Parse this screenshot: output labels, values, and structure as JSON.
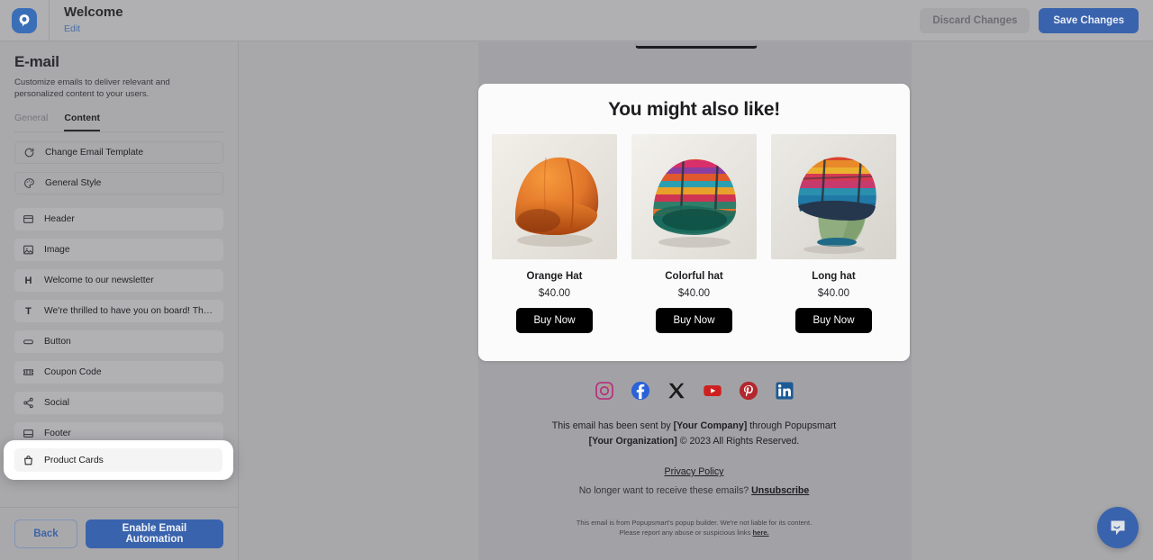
{
  "topbar": {
    "logo_icon": "popupsmart-logo-icon",
    "title": "Welcome",
    "edit_link": "Edit",
    "discard_label": "Discard Changes",
    "save_label": "Save Changes",
    "accent_color": "#3a63ad"
  },
  "sidebar": {
    "title": "E-mail",
    "description": "Customize emails to deliver relevant and personalized content to your users.",
    "tabs": [
      {
        "label": "General",
        "active": false
      },
      {
        "label": "Content",
        "active": true
      }
    ],
    "items": [
      {
        "label": "Change Email Template",
        "icon": "refresh-icon",
        "style": "outlined"
      },
      {
        "label": "General Style",
        "icon": "palette-icon",
        "style": "outlined"
      },
      {
        "label": "Header",
        "icon": "header-block-icon",
        "style": "filled"
      },
      {
        "label": "Image",
        "icon": "image-icon",
        "style": "filled"
      },
      {
        "label": "Welcome to our newsletter",
        "icon": "heading-h-icon",
        "style": "filled"
      },
      {
        "label": "We're thrilled to have you on board! Thank ...",
        "icon": "text-t-icon",
        "style": "filled"
      },
      {
        "label": "Button",
        "icon": "button-icon",
        "style": "filled"
      },
      {
        "label": "Coupon Code",
        "icon": "ticket-icon",
        "style": "filled"
      },
      {
        "label": "Social",
        "icon": "share-icon",
        "style": "filled"
      },
      {
        "label": "Footer",
        "icon": "footer-block-icon",
        "style": "filled"
      }
    ],
    "highlighted_item": {
      "label": "Product Cards",
      "icon": "shopping-bag-icon"
    },
    "back_label": "Back",
    "automation_label": "Enable Email Automation"
  },
  "email": {
    "card_title": "You might also like!",
    "products": [
      {
        "name": "Orange Hat",
        "price": "$40.00",
        "buy_label": "Buy Now",
        "image": "orange-beanie-photo"
      },
      {
        "name": "Colorful hat",
        "price": "$40.00",
        "buy_label": "Buy Now",
        "image": "colorful-beanie-photo"
      },
      {
        "name": "Long hat",
        "price": "$40.00",
        "buy_label": "Buy Now",
        "image": "long-beanie-on-mannequin-photo"
      }
    ],
    "social_icons": [
      {
        "name": "instagram-icon",
        "label": "Instagram"
      },
      {
        "name": "facebook-icon",
        "label": "Facebook"
      },
      {
        "name": "x-twitter-icon",
        "label": "X"
      },
      {
        "name": "youtube-icon",
        "label": "YouTube"
      },
      {
        "name": "pinterest-icon",
        "label": "Pinterest"
      },
      {
        "name": "linkedin-icon",
        "label": "LinkedIn"
      }
    ],
    "sent_by_line1_pre": "This email has been sent by ",
    "sent_by_company": "[Your Company]",
    "sent_by_line1_post": " through Popupsmart",
    "sent_by_organization": "[Your Organization]",
    "sent_by_line2_post": " © 2023 All Rights Reserved.",
    "privacy_policy": "Privacy Policy",
    "unsubscribe_prefix": "No longer want to receive these emails? ",
    "unsubscribe_label": "Unsubscribe",
    "fine_print_line1": "This email is from Popupsmart's popup builder. We're not liable for its content.",
    "fine_print_line2_pre": "Please report any abuse or suspicious links ",
    "fine_print_here": "here."
  },
  "chat": {
    "icon": "chat-bubble-icon"
  }
}
